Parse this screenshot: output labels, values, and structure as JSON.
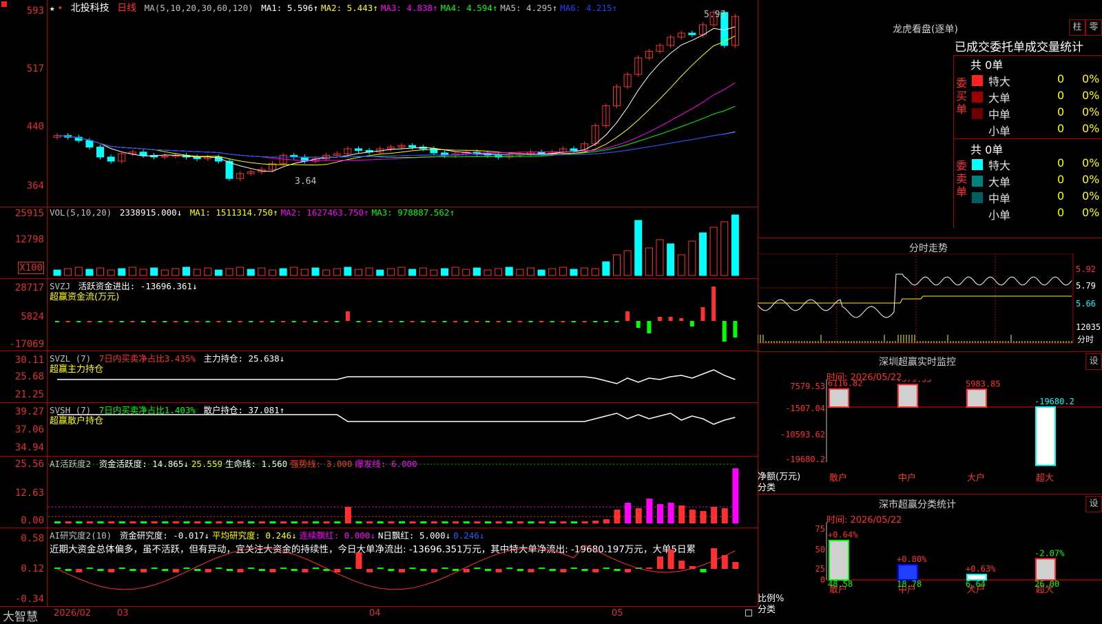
{
  "stock": {
    "name": "北投科技",
    "period": "日线"
  },
  "ma_header": {
    "label": "MA(5,10,20,30,60,120)",
    "items": [
      {
        "text": "MA1: 5.596↑",
        "color": "#ffffff"
      },
      {
        "text": "MA2: 5.443↑",
        "color": "#ffff00"
      },
      {
        "text": "MA3: 4.838↑",
        "color": "#ff00ff"
      },
      {
        "text": "MA4: 4.594↑",
        "color": "#00ff00"
      },
      {
        "text": "MA5: 4.295↑",
        "color": "#c0c0c0"
      },
      {
        "text": "MA6: 4.215↑",
        "color": "#2040ff"
      }
    ]
  },
  "price_axis": [
    "593",
    "517",
    "440",
    "364"
  ],
  "price_labels": {
    "high": "5.93",
    "low": "3.64"
  },
  "vol_header": {
    "label": "VOL(5,10,20)",
    "value": "2338915.000↓",
    "items": [
      {
        "text": "MA1: 1511314.750↑",
        "color": "#ffff00"
      },
      {
        "text": "MA2: 1627463.750↑",
        "color": "#ff00ff"
      },
      {
        "text": "MA3: 978887.562↑",
        "color": "#00ff00"
      }
    ]
  },
  "vol_axis": [
    "25915",
    "12798",
    "X100"
  ],
  "svzj": {
    "label": "SVZJ",
    "title": "活跃资金进出: -13696.361↓",
    "sub": "超赢资金流(万元)",
    "axis": [
      "28717",
      "5824",
      "-17069"
    ]
  },
  "svzl": {
    "label": "SVZL (7)",
    "ratio": "7日内买卖净占比3.435%",
    "title": "主力持仓: 25.638↓",
    "sub": "超赢主力持仓",
    "axis": [
      "30.11",
      "25.68",
      "21.25"
    ]
  },
  "svsh": {
    "label": "SVSH (7)",
    "ratio": "7日内买卖净占比1.403%",
    "title": "散户持仓: 37.081↑",
    "sub": "超赢散户持仓",
    "axis": [
      "39.27",
      "37.06",
      "34.94"
    ]
  },
  "ai_active": {
    "label": "AI活跃度2",
    "items": [
      {
        "text": "资金活跃度: 14.865↓",
        "color": "#ffffff"
      },
      {
        "text": "25.559",
        "color": "#ffff00"
      },
      {
        "text": "生命线: 1.560",
        "color": "#ffffff"
      },
      {
        "text": "强势线: 3.000",
        "color": "#ff3030"
      },
      {
        "text": "爆发线: 6.000",
        "color": "#ff00ff"
      }
    ],
    "axis": [
      "25.56",
      "12.63",
      "0.00"
    ]
  },
  "ai_research": {
    "label": "AI研究度2(10)",
    "items": [
      {
        "text": "资金研究度: -0.017↓",
        "color": "#ffffff"
      },
      {
        "text": "平均研究度: 0.246↓",
        "color": "#ffff00"
      },
      {
        "text": "连续飘红: 0.000↓",
        "color": "#ff00ff"
      },
      {
        "text": "N日飘红: 5.000↓",
        "color": "#ffffff"
      },
      {
        "text": "0.246↓",
        "color": "#2060ff"
      }
    ],
    "desc": "近期大资金总体偏多，虽不活跃，但有异动，宜关注大资金的持续性，今日大单净流出: -13696.351万元，其中特大单净流出: -19680.197万元，大单5日累",
    "axis": [
      "0.58",
      "0.12",
      "-0.34"
    ]
  },
  "bottom": {
    "brand": "大智慧",
    "dates": [
      "2026/02",
      "03",
      "04",
      "05"
    ]
  },
  "dragon": {
    "title": "龙虎看盘(逐单)",
    "btn1": "柱",
    "btn2": "零",
    "header": "已成交委托单成交量统计",
    "buy": {
      "side": "委买单",
      "total": "共 0单",
      "rows": [
        {
          "name": "特大",
          "val": "0",
          "pct": "0%",
          "color": "#ff2020"
        },
        {
          "name": "大单",
          "val": "0",
          "pct": "0%",
          "color": "#a00000"
        },
        {
          "name": "中单",
          "val": "0",
          "pct": "0%",
          "color": "#700000"
        },
        {
          "name": "小单",
          "val": "0",
          "pct": "0%",
          "color": "#000000"
        }
      ]
    },
    "sell": {
      "side": "委卖单",
      "total": "共 0单",
      "rows": [
        {
          "name": "特大",
          "val": "0",
          "pct": "0%",
          "color": "#00ffff"
        },
        {
          "name": "大单",
          "val": "0",
          "pct": "0%",
          "color": "#008080"
        },
        {
          "name": "中单",
          "val": "0",
          "pct": "0%",
          "color": "#006060"
        },
        {
          "name": "小单",
          "val": "0",
          "pct": "0%",
          "color": "#000000"
        }
      ]
    }
  },
  "intraday": {
    "title": "分时走势",
    "axis": [
      "5.92",
      "5.79",
      "5.66",
      "12035",
      "分时"
    ]
  },
  "sz_monitor": {
    "title": "深圳超赢实时监控",
    "btn": "设",
    "time": "时间: 2026/05/22",
    "axis": [
      "7579.53",
      "-1507.04",
      "-10593.62",
      "-19680.2"
    ],
    "ylabel": "净额(万元)",
    "xlabel": "分类"
  },
  "sz_class": {
    "title": "深市超赢分类统计",
    "btn": "设",
    "time": "时间: 2026/05/22",
    "axis": [
      "75",
      "50",
      "25",
      "0"
    ],
    "ylabel": "比例%",
    "xlabel": "分类"
  },
  "chart_data": [
    {
      "type": "bar",
      "title": "深圳超赢实时监控",
      "xlabel": "分类",
      "ylabel": "净额(万元)",
      "categories": [
        "散户",
        "中户",
        "大户",
        "超大"
      ],
      "values": [
        6116.82,
        7579.53,
        5983.85,
        -19680.2
      ],
      "ylim": [
        -19680.2,
        7579.53
      ]
    },
    {
      "type": "bar",
      "title": "深市超赢分类统计",
      "xlabel": "分类",
      "ylabel": "比例%",
      "categories": [
        "散户",
        "中户",
        "大户",
        "超大"
      ],
      "values": [
        48.58,
        18.78,
        6.64,
        26.0
      ],
      "changes": [
        "+0.64%",
        "+0.80%",
        "+0.63%",
        "-2.07%"
      ],
      "ylim": [
        0,
        75
      ]
    }
  ]
}
